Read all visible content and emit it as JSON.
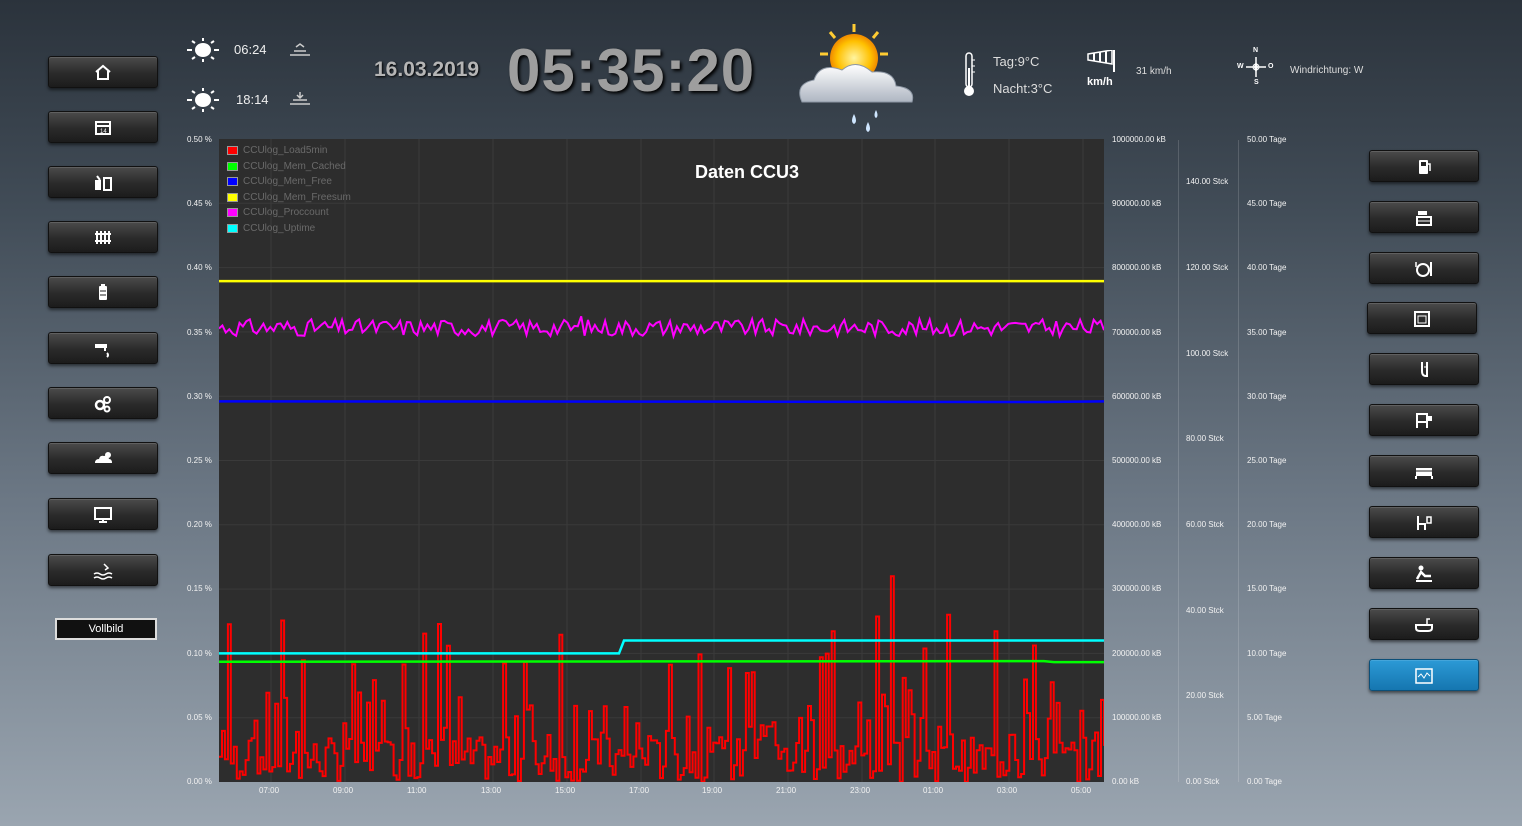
{
  "sun": {
    "rise": "06:24",
    "set": "18:14"
  },
  "date": "16.03.2019",
  "clock": "05:35:20",
  "weather": {
    "day": "Tag:9°C",
    "night": "Nacht:3°C",
    "wind_speed": "31 km/h",
    "wind_unit": "km/h",
    "wind_dir": "Windrichtung: W",
    "compass": [
      "N",
      "W",
      "O",
      "S"
    ],
    "icon": "partly-cloudy-rain-icon"
  },
  "fullscreen_label": "Vollbild",
  "left_nav": [
    "home-icon",
    "calendar-icon",
    "energy-meter-icon",
    "heater-icon",
    "battery-icon",
    "water-tap-icon",
    "settings-gears-icon",
    "weather-icon",
    "monitor-icon",
    "pool-icon"
  ],
  "right_nav": [
    "fuel-icon",
    "kitchen-icon",
    "dining-icon",
    "oven-icon",
    "bath-icon",
    "bedroom-icon",
    "bed-icon",
    "dressing-icon",
    "massage-icon",
    "bathtub-icon",
    "diagnostics-icon"
  ],
  "chart_data": {
    "type": "line",
    "title": "Daten CCU3",
    "x_ticks": [
      "07:00",
      "09:00",
      "11:00",
      "13:00",
      "15:00",
      "17:00",
      "19:00",
      "21:00",
      "23:00",
      "01:00",
      "03:00",
      "05:00"
    ],
    "axes": {
      "pct": [
        "0.00 %",
        "0.05 %",
        "0.10 %",
        "0.15 %",
        "0.20 %",
        "0.25 %",
        "0.30 %",
        "0.35 %",
        "0.40 %",
        "0.45 %",
        "0.50 %"
      ],
      "kb": [
        "0.00 kB",
        "100000.00 kB",
        "200000.00 kB",
        "300000.00 kB",
        "400000.00 kB",
        "500000.00 kB",
        "600000.00 kB",
        "700000.00 kB",
        "800000.00 kB",
        "900000.00 kB",
        "1000000.00 kB"
      ],
      "stck": [
        "0.00 Stck",
        "20.00 Stck",
        "40.00 Stck",
        "60.00 Stck",
        "80.00 Stck",
        "100.00 Stck",
        "120.00 Stck",
        "140.00 Stck"
      ],
      "tage": [
        "0.00 Tage",
        "5.00 Tage",
        "10.00 Tage",
        "15.00 Tage",
        "20.00 Tage",
        "25.00 Tage",
        "30.00 Tage",
        "35.00 Tage",
        "40.00 Tage",
        "45.00 Tage",
        "50.00 Tage"
      ]
    },
    "ylim_pct": [
      0,
      0.5
    ],
    "series": [
      {
        "name": "CCUlog_Load5min",
        "color": "#ff0000",
        "axis": "pct",
        "range": [
          0.0,
          0.16
        ]
      },
      {
        "name": "CCUlog_Mem_Cached",
        "color": "#00ff00",
        "axis": "kb",
        "values": [
          187000,
          187000,
          188000,
          188000,
          187000
        ]
      },
      {
        "name": "CCUlog_Mem_Free",
        "color": "#0000ff",
        "axis": "kb",
        "values": [
          592000,
          592000,
          591000,
          591000,
          592000
        ]
      },
      {
        "name": "CCUlog_Mem_Freesum",
        "color": "#ffff00",
        "axis": "kb",
        "values": [
          779000,
          779000,
          779000,
          779000,
          779000
        ]
      },
      {
        "name": "CCUlog_Proccount",
        "color": "#ff00ff",
        "axis": "stck",
        "range": [
          104,
          108
        ]
      },
      {
        "name": "CCUlog_Uptime",
        "color": "#00ffff",
        "axis": "tage",
        "values": [
          10.0,
          10.0,
          11.0,
          11.0,
          11.0
        ]
      }
    ]
  }
}
